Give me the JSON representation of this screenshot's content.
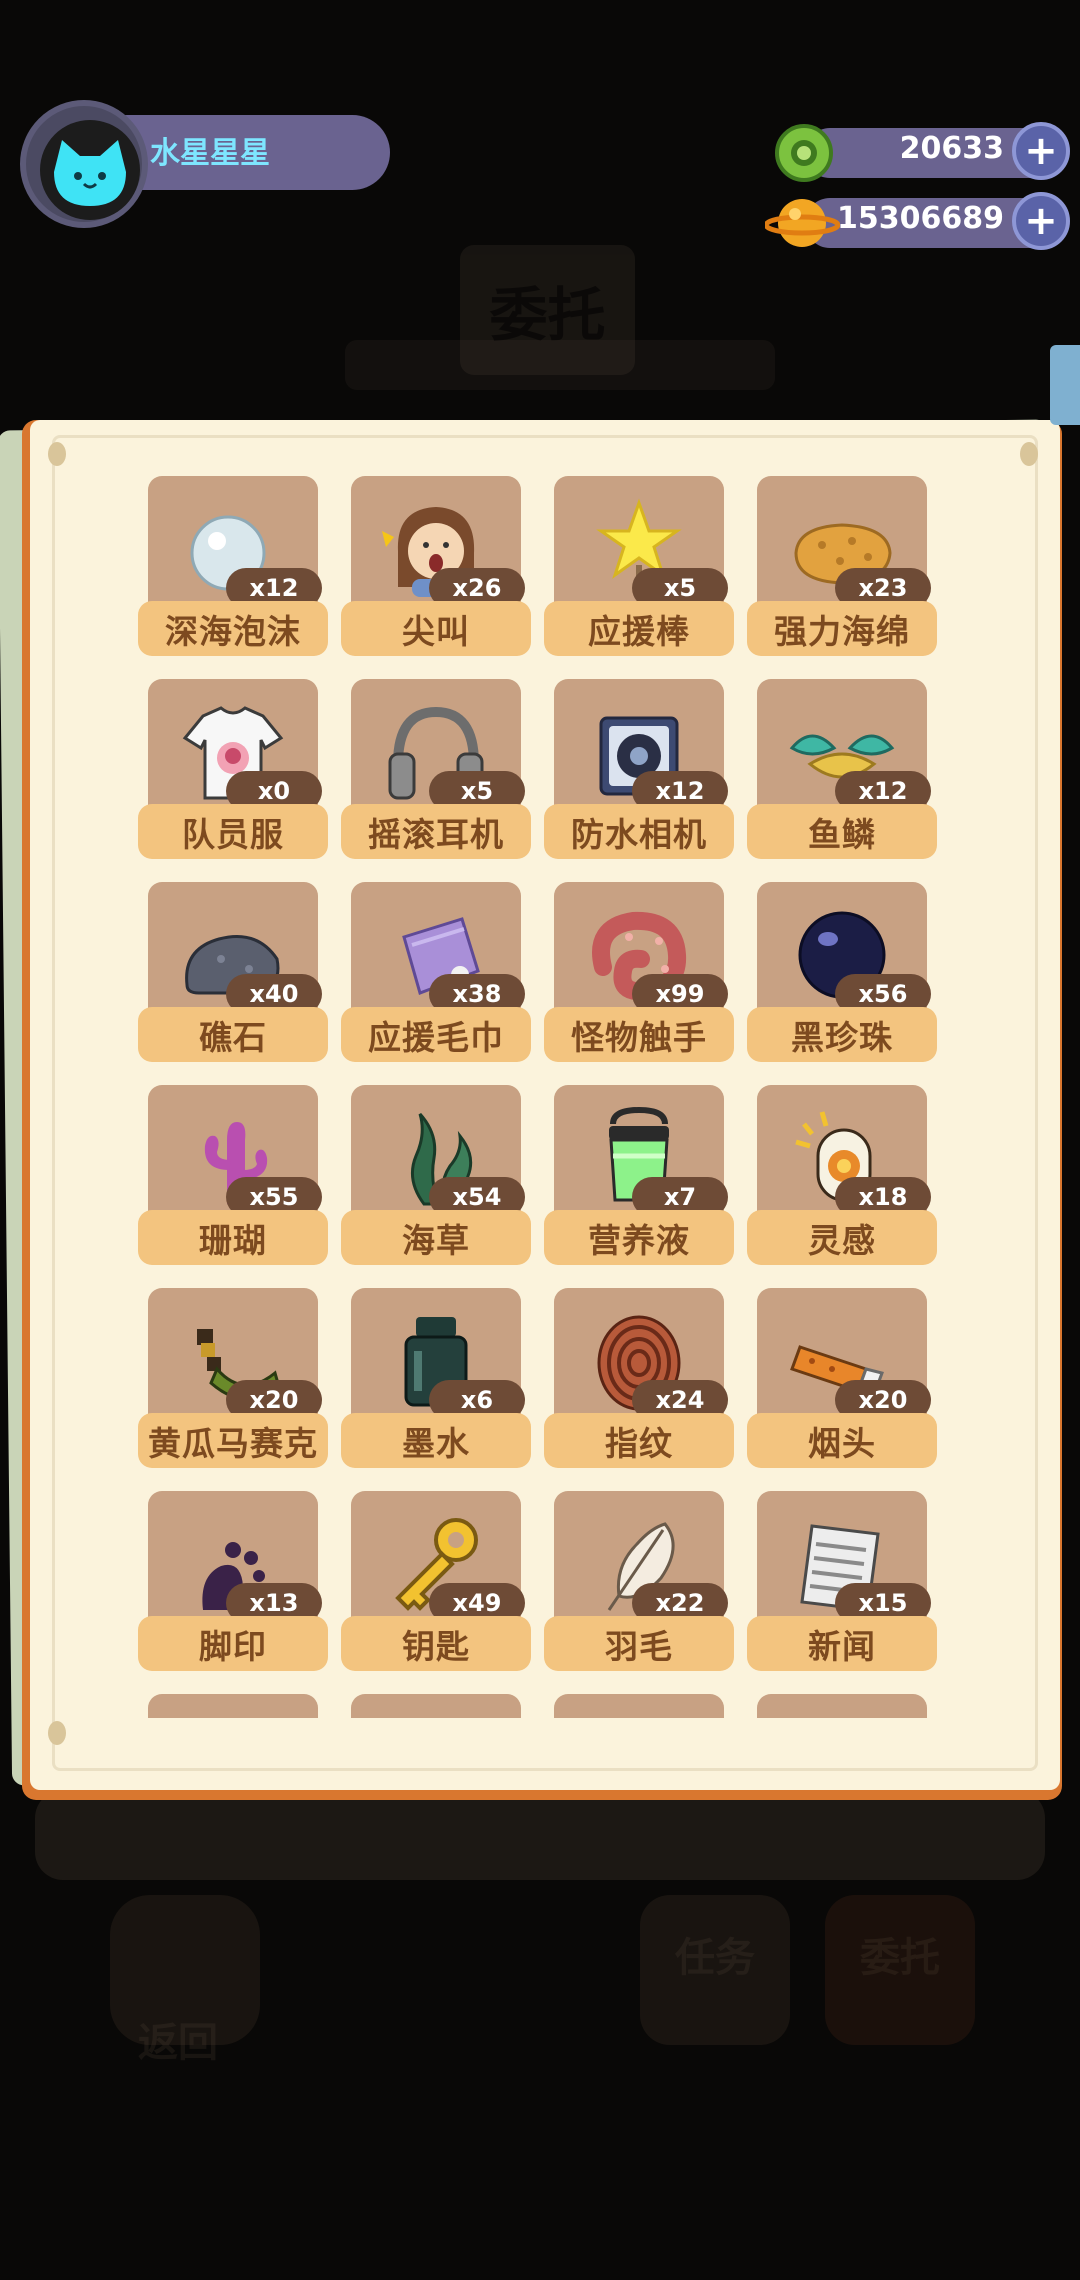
{
  "player": {
    "name": "水星星星"
  },
  "currencies": [
    {
      "icon": "green-gem-icon",
      "value": "20633"
    },
    {
      "icon": "planet-coin-icon",
      "value": "15306689"
    }
  ],
  "items": [
    {
      "name": "深海泡沫",
      "count": "x12",
      "icon": "bubble-icon"
    },
    {
      "name": "尖叫",
      "count": "x26",
      "icon": "screaming-girl-icon"
    },
    {
      "name": "应援棒",
      "count": "x5",
      "icon": "star-wand-icon"
    },
    {
      "name": "强力海绵",
      "count": "x23",
      "icon": "sponge-icon"
    },
    {
      "name": "队员服",
      "count": "x0",
      "icon": "tshirt-icon"
    },
    {
      "name": "摇滚耳机",
      "count": "x5",
      "icon": "headphones-icon"
    },
    {
      "name": "防水相机",
      "count": "x12",
      "icon": "camera-icon"
    },
    {
      "name": "鱼鳞",
      "count": "x12",
      "icon": "fish-scale-icon"
    },
    {
      "name": "礁石",
      "count": "x40",
      "icon": "rock-icon"
    },
    {
      "name": "应援毛巾",
      "count": "x38",
      "icon": "towel-icon"
    },
    {
      "name": "怪物触手",
      "count": "x99",
      "icon": "tentacle-icon"
    },
    {
      "name": "黑珍珠",
      "count": "x56",
      "icon": "black-pearl-icon"
    },
    {
      "name": "珊瑚",
      "count": "x55",
      "icon": "coral-icon"
    },
    {
      "name": "海草",
      "count": "x54",
      "icon": "seaweed-icon"
    },
    {
      "name": "营养液",
      "count": "x7",
      "icon": "nutrient-jar-icon"
    },
    {
      "name": "灵感",
      "count": "x18",
      "icon": "inspiration-icon"
    },
    {
      "name": "黄瓜马赛克",
      "count": "x20",
      "icon": "cucumber-icon"
    },
    {
      "name": "墨水",
      "count": "x6",
      "icon": "ink-bottle-icon"
    },
    {
      "name": "指纹",
      "count": "x24",
      "icon": "fingerprint-icon"
    },
    {
      "name": "烟头",
      "count": "x20",
      "icon": "cigarette-butt-icon"
    },
    {
      "name": "脚印",
      "count": "x13",
      "icon": "footprint-icon"
    },
    {
      "name": "钥匙",
      "count": "x49",
      "icon": "key-icon"
    },
    {
      "name": "羽毛",
      "count": "x22",
      "icon": "feather-icon"
    },
    {
      "name": "新闻",
      "count": "x15",
      "icon": "newspaper-icon"
    }
  ],
  "background": {
    "title": "委托",
    "back_label": "返回",
    "task_label": "任务",
    "commission_label": "委托"
  }
}
